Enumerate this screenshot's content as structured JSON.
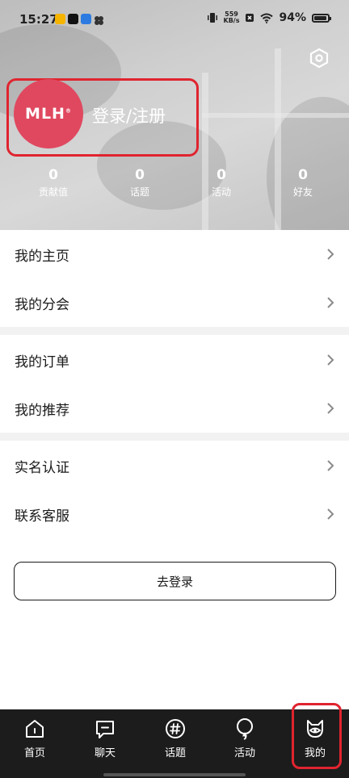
{
  "status_bar": {
    "time": "15:27",
    "net_speed_value": "559",
    "net_speed_unit": "KB/s",
    "battery": "94%",
    "app_icons": [
      "weibo-icon",
      "tiktok-icon",
      "app-icon",
      "pinwheel-icon"
    ]
  },
  "profile": {
    "avatar_logo": "MLH",
    "avatar_logo_mark": "®",
    "login_title": "登录/注册"
  },
  "stats": [
    {
      "value": "0",
      "label": "贡献值"
    },
    {
      "value": "0",
      "label": "话题"
    },
    {
      "value": "0",
      "label": "活动"
    },
    {
      "value": "0",
      "label": "好友"
    }
  ],
  "menu": {
    "group1": [
      {
        "label": "我的主页"
      },
      {
        "label": "我的分会"
      }
    ],
    "group2": [
      {
        "label": "我的订单"
      },
      {
        "label": "我的推荐"
      }
    ],
    "group3": [
      {
        "label": "实名认证"
      },
      {
        "label": "联系客服"
      }
    ]
  },
  "login_button": "去登录",
  "tabbar": {
    "active": "我的",
    "tabs": [
      {
        "label": "首页",
        "icon": "home-icon"
      },
      {
        "label": "聊天",
        "icon": "chat-icon"
      },
      {
        "label": "话题",
        "icon": "hashtag-icon"
      },
      {
        "label": "活动",
        "icon": "balloon-icon"
      },
      {
        "label": "我的",
        "icon": "profile-face-icon"
      }
    ]
  },
  "colors": {
    "avatar": "#e0485f",
    "highlight": "#e0242f",
    "tabbar_bg": "#1c1c1c"
  }
}
